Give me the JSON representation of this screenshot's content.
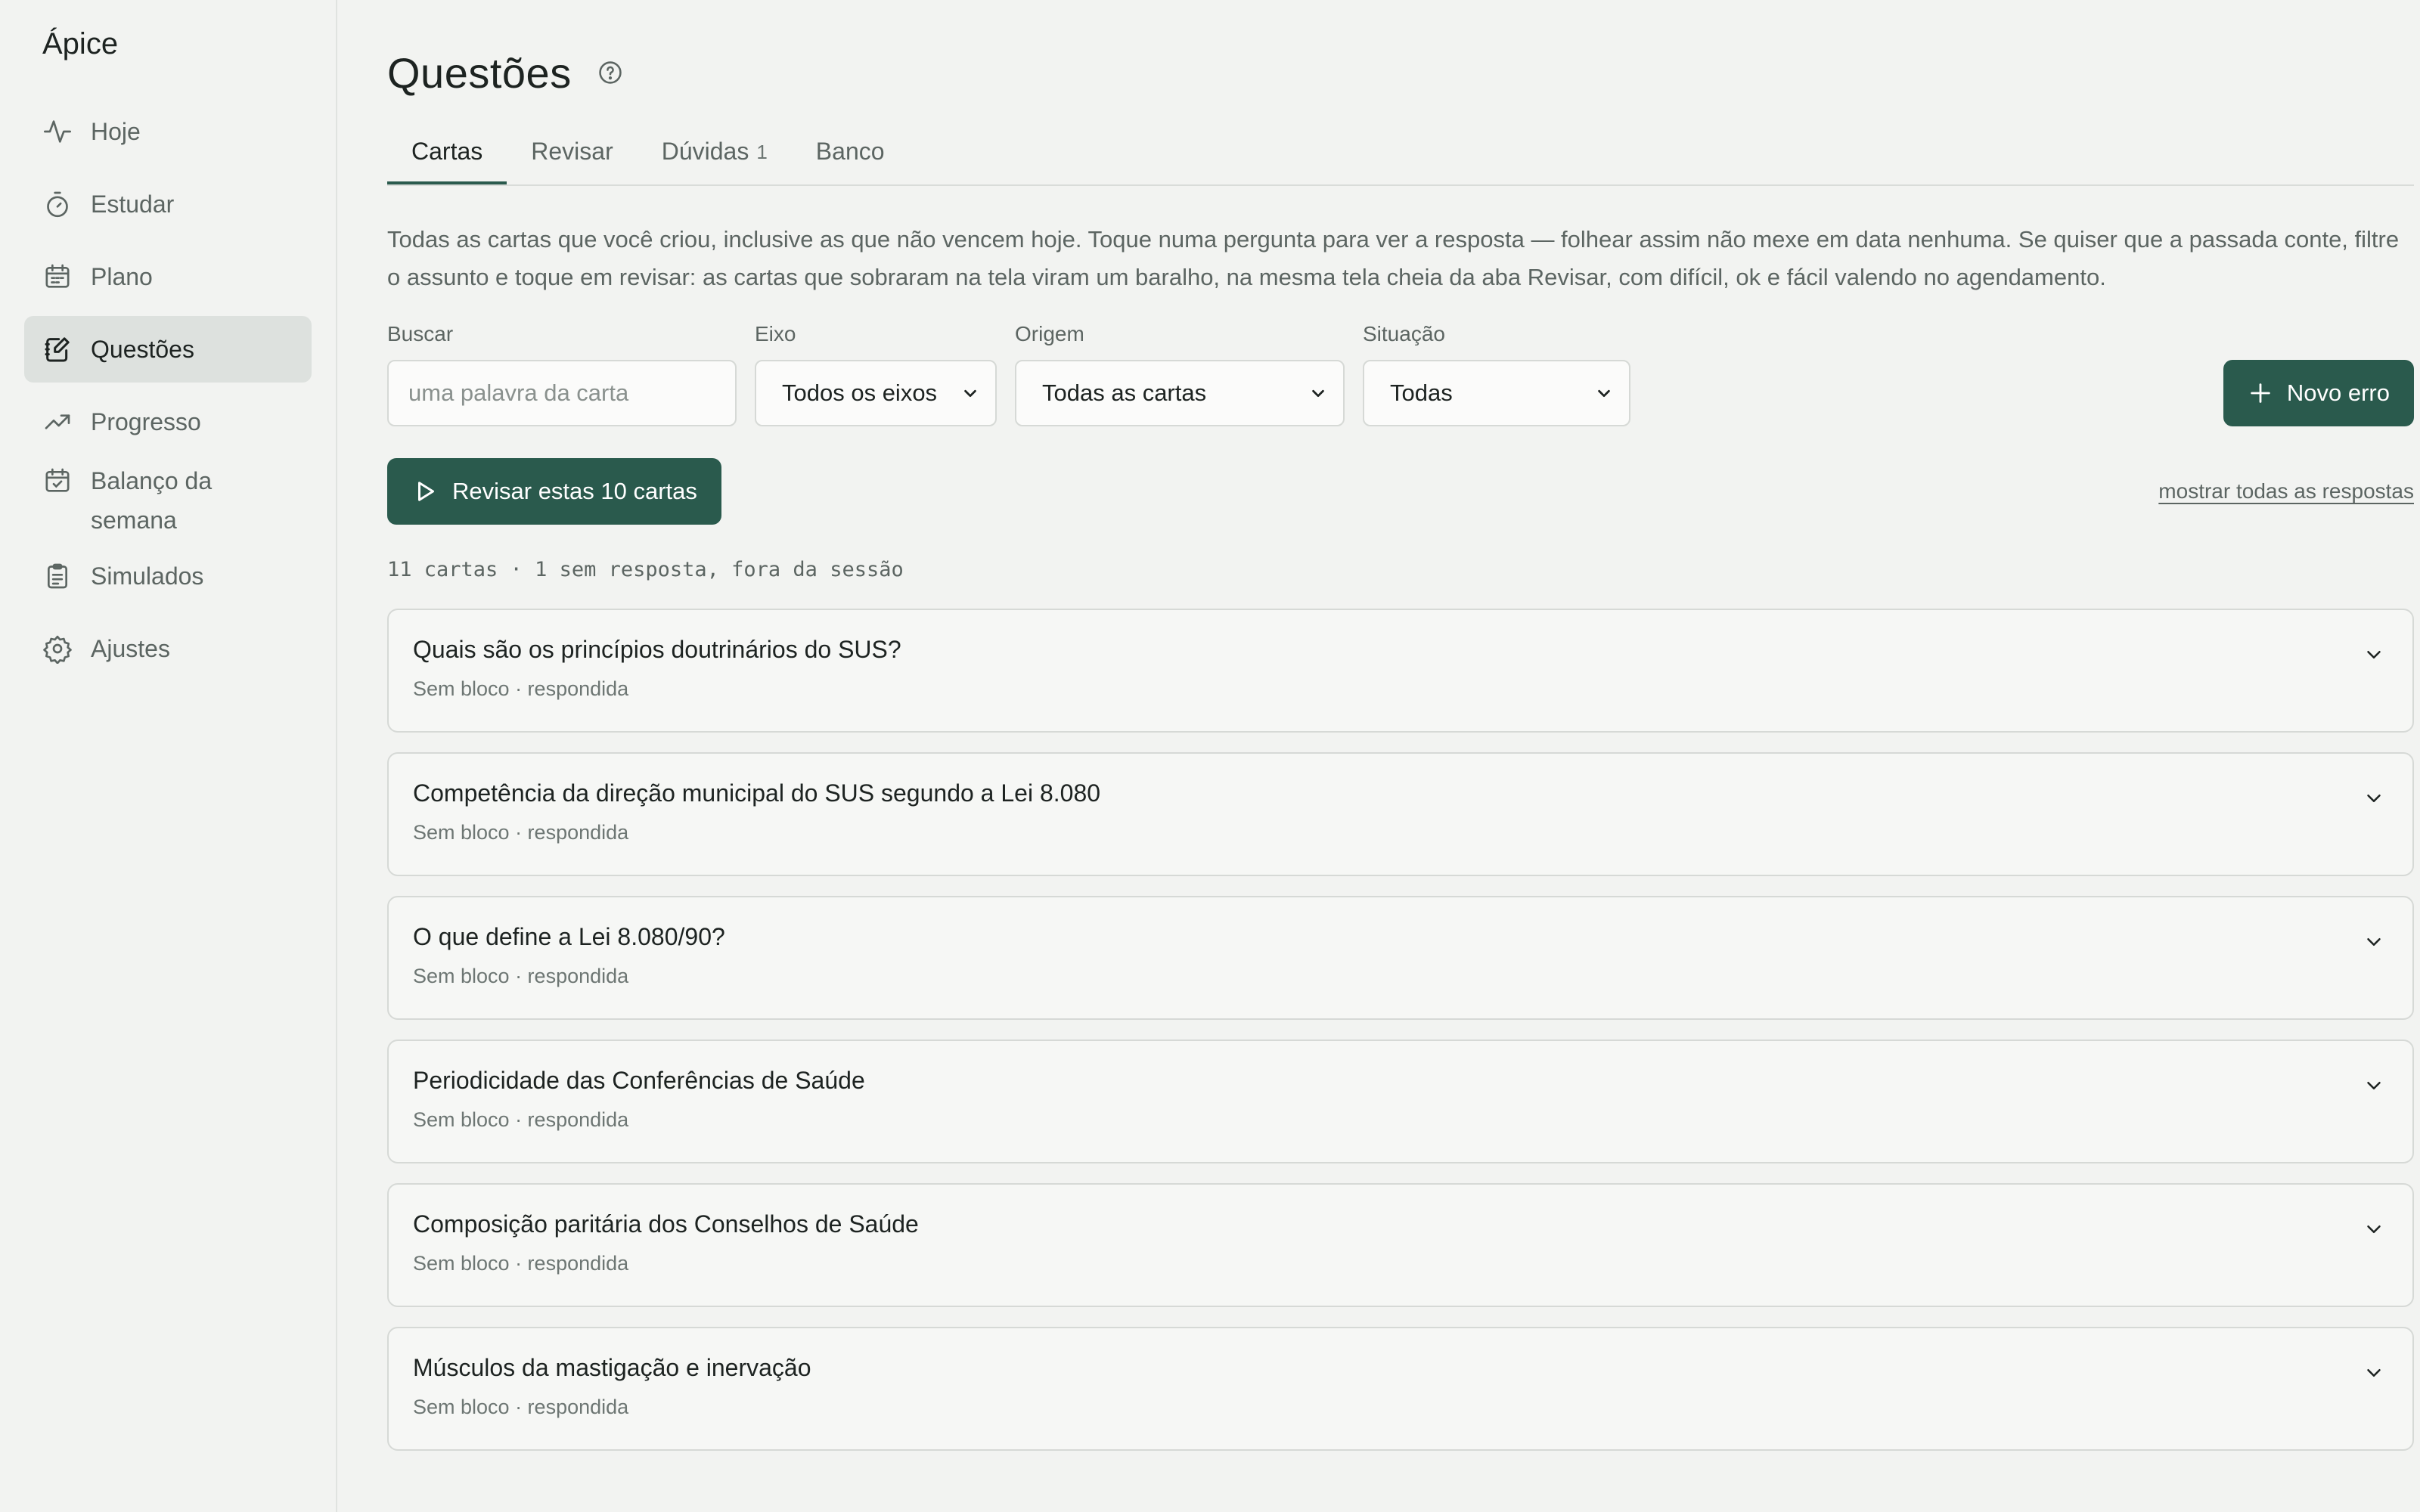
{
  "sidebar": {
    "brand": "Ápice",
    "items": [
      {
        "label": "Hoje",
        "icon": "activity-icon"
      },
      {
        "label": "Estudar",
        "icon": "timer-icon"
      },
      {
        "label": "Plano",
        "icon": "calendar-icon"
      },
      {
        "label": "Questões",
        "icon": "edit-note-icon",
        "active": true
      },
      {
        "label": "Progresso",
        "icon": "trend-up-icon"
      },
      {
        "label": "Balanço da semana",
        "icon": "calendar-check-icon"
      },
      {
        "label": "Simulados",
        "icon": "clipboard-icon"
      },
      {
        "label": "Ajustes",
        "icon": "gear-icon"
      }
    ]
  },
  "header": {
    "title": "Questões",
    "help_icon": "help-circle-icon"
  },
  "tabs": [
    {
      "label": "Cartas",
      "active": true
    },
    {
      "label": "Revisar"
    },
    {
      "label": "Dúvidas",
      "count": "1"
    },
    {
      "label": "Banco"
    }
  ],
  "description": "Todas as cartas que você criou, inclusive as que não vencem hoje. Toque numa pergunta para ver a resposta — folhear assim não mexe em data nenhuma. Se quiser que a passada conte, filtre o assunto e toque em revisar: as cartas que sobraram na tela viram um baralho, na mesma tela cheia da aba Revisar, com difícil, ok e fácil valendo no agendamento.",
  "filters": {
    "search": {
      "label": "Buscar",
      "placeholder": "uma palavra da carta"
    },
    "eixo": {
      "label": "Eixo",
      "value": "Todos os eixos"
    },
    "origem": {
      "label": "Origem",
      "value": "Todas as cartas"
    },
    "situacao": {
      "label": "Situação",
      "value": "Todas"
    }
  },
  "buttons": {
    "novo_erro": "Novo erro",
    "revisar": "Revisar estas 10 cartas",
    "mostrar": "mostrar todas as respostas"
  },
  "meta": "11 cartas · 1 sem resposta, fora da sessão",
  "cards": [
    {
      "question": "Quais são os princípios doutrinários do SUS?",
      "sub": "Sem bloco · respondida"
    },
    {
      "question": "Competência da direção municipal do SUS segundo a Lei 8.080",
      "sub": "Sem bloco · respondida"
    },
    {
      "question": "O que define a Lei 8.080/90?",
      "sub": "Sem bloco · respondida"
    },
    {
      "question": "Periodicidade das Conferências de Saúde",
      "sub": "Sem bloco · respondida"
    },
    {
      "question": "Composição paritária dos Conselhos de Saúde",
      "sub": "Sem bloco · respondida"
    },
    {
      "question": "Músculos da mastigação e inervação",
      "sub": "Sem bloco · respondida"
    }
  ],
  "colors": {
    "accent": "#2a5a4d",
    "background": "#f2f3f1",
    "active_nav": "#dde1de"
  }
}
